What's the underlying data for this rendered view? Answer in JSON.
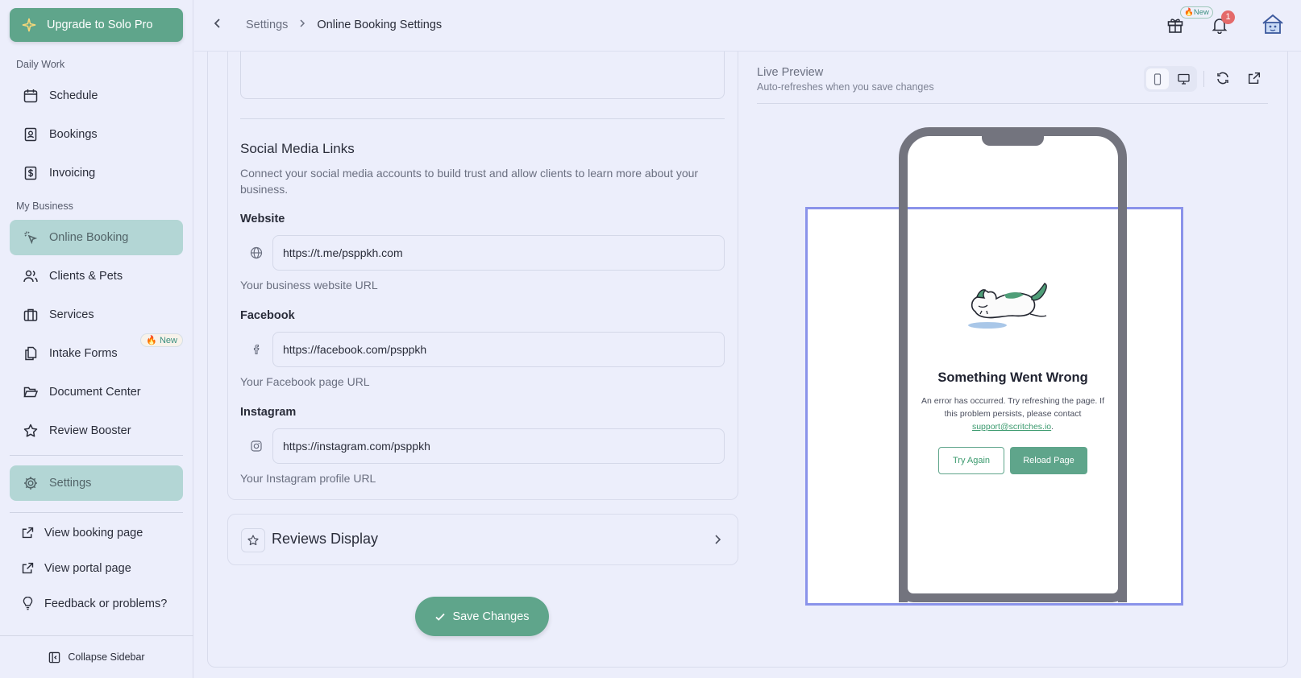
{
  "sidebar": {
    "upgrade_label": "Upgrade to Solo Pro",
    "daily_work_label": "Daily Work",
    "my_business_label": "My Business",
    "items": [
      {
        "label": "Schedule"
      },
      {
        "label": "Bookings"
      },
      {
        "label": "Invoicing"
      },
      {
        "label": "Online Booking"
      },
      {
        "label": "Clients & Pets"
      },
      {
        "label": "Services"
      },
      {
        "label": "Intake Forms",
        "badge": "🔥 New"
      },
      {
        "label": "Document Center"
      },
      {
        "label": "Review Booster"
      },
      {
        "label": "Settings"
      }
    ],
    "links": [
      {
        "label": "View booking page"
      },
      {
        "label": "View portal page"
      },
      {
        "label": "Feedback or problems?"
      }
    ],
    "collapse_label": "Collapse Sidebar"
  },
  "header": {
    "breadcrumb": [
      "Settings",
      "Online Booking Settings"
    ],
    "gift_badge": "🔥New",
    "notification_count": "1"
  },
  "social": {
    "title": "Social Media Links",
    "description": "Connect your social media accounts to build trust and allow clients to learn more about your business.",
    "fields": [
      {
        "label": "Website",
        "value": "https://t.me/psppkh.com",
        "hint": "Your business website URL"
      },
      {
        "label": "Facebook",
        "value": "https://facebook.com/psppkh",
        "hint": "Your Facebook page URL"
      },
      {
        "label": "Instagram",
        "value": "https://instagram.com/psppkh",
        "hint": "Your Instagram profile URL"
      }
    ]
  },
  "reviews": {
    "title": "Reviews Display"
  },
  "save_label": "Save Changes",
  "preview": {
    "title": "Live Preview",
    "subtitle": "Auto-refreshes when you save changes",
    "error_title": "Something Went Wrong",
    "error_text": "An error has occurred. Try refreshing the page. If this problem persists, please contact",
    "error_email": "support@scritches.io",
    "try_label": "Try Again",
    "reload_label": "Reload Page"
  },
  "colors": {
    "brand": "#5fa58b",
    "active_nav": "#b3d6d5",
    "selection": "#8a93ea",
    "badge_red": "#e46a6a"
  }
}
